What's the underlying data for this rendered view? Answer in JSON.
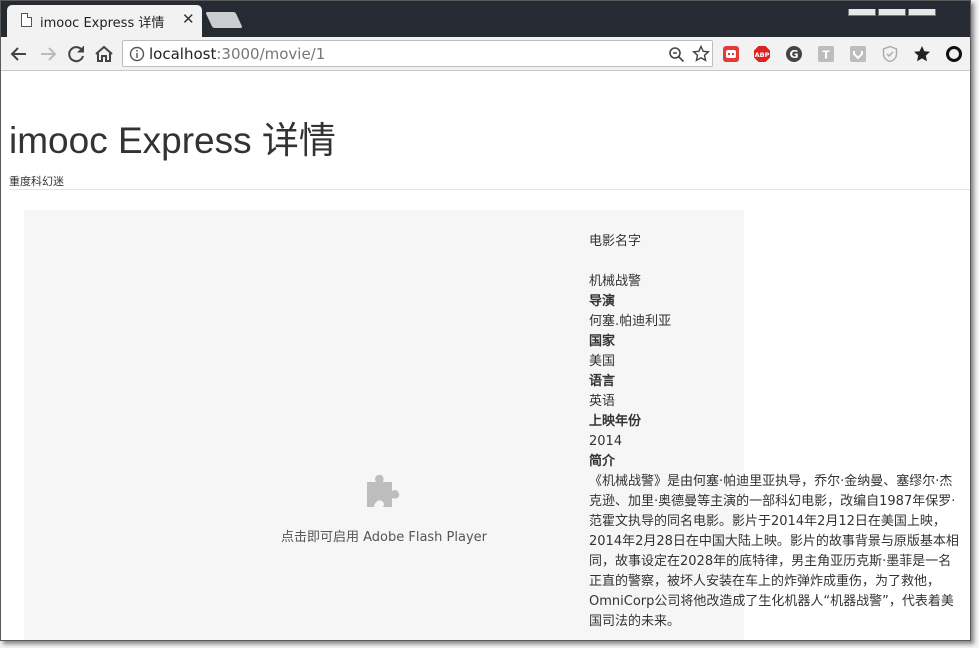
{
  "browser": {
    "tab_title": "imooc Express 详情",
    "tab_close": "✕",
    "url_host": "localhost",
    "url_rest": ":3000/movie/1"
  },
  "icons": [
    "document-icon",
    "close-icon",
    "back-icon",
    "forward-icon",
    "reload-icon",
    "home-icon",
    "info-icon",
    "zoom-icon",
    "star-icon",
    "ext-red-icon",
    "abp-icon",
    "grammarly-icon",
    "translate-icon",
    "pocket-icon",
    "shield-icon",
    "bookmark-star-icon",
    "ring-icon",
    "puzzle-icon"
  ],
  "extensions": {
    "abp": "ABP",
    "grammarly": "G",
    "translate": "T"
  },
  "header": {
    "title": "imooc Express 详情",
    "subtitle": "重度科幻迷"
  },
  "flash": {
    "message": "点击即可启用 Adobe Flash Player"
  },
  "movie": {
    "name_label": "电影名字",
    "name": "机械战警",
    "director_label": "导演",
    "director": "何塞.帕迪利亚",
    "country_label": "国家",
    "country": "美国",
    "language_label": "语言",
    "language": "英语",
    "year_label": "上映年份",
    "year": "2014",
    "summary_label": "简介",
    "summary": "《机械战警》是由何塞·帕迪里亚执导，乔尔·金纳曼、塞缪尔·杰克逊、加里·奥德曼等主演的一部科幻电影，改编自1987年保罗·范霍文执导的同名电影。影片于2014年2月12日在美国上映，2014年2月28日在中国大陆上映。影片的故事背景与原版基本相同，故事设定在2028年的底特律，男主角亚历克斯·墨菲是一名正直的警察，被坏人安装在车上的炸弹炸成重伤，为了救他，OmniCorp公司将他改造成了生化机器人“机器战警”，代表着美国司法的未来。"
  }
}
